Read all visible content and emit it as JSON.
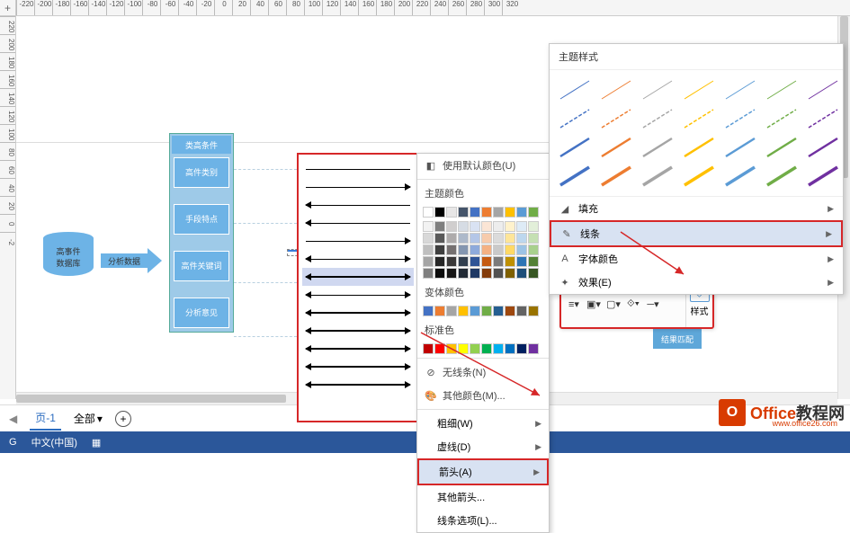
{
  "ruler_h": [
    "-220",
    "-200",
    "-180",
    "-160",
    "-140",
    "-120",
    "-100",
    "-80",
    "-60",
    "-40",
    "-20",
    "0",
    "20",
    "40",
    "60",
    "80",
    "100",
    "120",
    "140",
    "160",
    "180",
    "200",
    "220",
    "240",
    "260",
    "280",
    "300",
    "320"
  ],
  "ruler_v": [
    "220",
    "200",
    "180",
    "160",
    "140",
    "120",
    "100",
    "80",
    "60",
    "40",
    "20",
    "0",
    "-2"
  ],
  "shapes": {
    "db_line1": "高事件",
    "db_line2": "数据库",
    "arrow_label": "分析数据",
    "group_title": "类高条件",
    "box1": "高件类别",
    "box2": "手段特点",
    "box3": "高件关键词",
    "box4": "分析意见",
    "result": "结果匹配"
  },
  "color_menu": {
    "default_label": "使用默认颜色(U)",
    "theme_label": "主题颜色",
    "variant_label": "变体颜色",
    "standard_label": "标准色",
    "no_line": "无线条(N)",
    "other_colors": "其他颜色(M)...",
    "weight": "粗细(W)",
    "dashes": "虚线(D)",
    "arrows": "箭头(A)",
    "other_arrows": "其他箭头...",
    "line_options": "线条选项(L)..."
  },
  "theme_panel": {
    "title": "主题样式",
    "fill": "填充",
    "line": "线条",
    "font_color": "字体颜色",
    "effects": "效果(E)"
  },
  "mini_tb": {
    "style": "样式"
  },
  "page_bar": {
    "page_tab": "页-1",
    "all": "全部"
  },
  "status": {
    "lang": "中文(中国)"
  },
  "watermark": {
    "text1": "Office",
    "text2": "教程网",
    "sub": "www.office26.com"
  },
  "theme_colors": [
    [
      "#4472c4",
      "#ed7d31",
      "#a5a5a5",
      "#ffc000",
      "#5b9bd5",
      "#70ad47",
      "#7030a0"
    ],
    [
      "#4472c4",
      "#ed7d31",
      "#a5a5a5",
      "#ffc000",
      "#5b9bd5",
      "#70ad47",
      "#7030a0"
    ],
    [
      "#4472c4",
      "#ed7d31",
      "#a5a5a5",
      "#ffc000",
      "#5b9bd5",
      "#70ad47",
      "#7030a0"
    ],
    [
      "#4472c4",
      "#ed7d31",
      "#a5a5a5",
      "#ffc000",
      "#5b9bd5",
      "#70ad47",
      "#7030a0"
    ]
  ],
  "cm_theme_colors": [
    "#ffffff",
    "#000000",
    "#e7e6e6",
    "#44546a",
    "#4472c4",
    "#ed7d31",
    "#a5a5a5",
    "#ffc000",
    "#5b9bd5",
    "#70ad47"
  ],
  "cm_theme_shades": [
    [
      "#f2f2f2",
      "#7f7f7f",
      "#d0cece",
      "#d6dce4",
      "#d9e2f3",
      "#fbe5d5",
      "#ededed",
      "#fff2cc",
      "#deebf6",
      "#e2efd9"
    ],
    [
      "#d8d8d8",
      "#595959",
      "#aeabab",
      "#adb9ca",
      "#b4c6e7",
      "#f7cbac",
      "#dbdbdb",
      "#fee599",
      "#bdd7ee",
      "#c5e0b3"
    ],
    [
      "#bfbfbf",
      "#3f3f3f",
      "#757070",
      "#8496b0",
      "#8eaadb",
      "#f4b183",
      "#c9c9c9",
      "#ffd965",
      "#9cc3e5",
      "#a8d08d"
    ],
    [
      "#a5a5a5",
      "#262626",
      "#3a3838",
      "#323f4f",
      "#2f5496",
      "#c55a11",
      "#7b7b7b",
      "#bf9000",
      "#2e75b5",
      "#538135"
    ],
    [
      "#7f7f7f",
      "#0c0c0c",
      "#171616",
      "#222a35",
      "#1f3864",
      "#833c0b",
      "#525252",
      "#7f6000",
      "#1e4e79",
      "#375623"
    ]
  ],
  "cm_variant_colors": [
    "#4472c4",
    "#ed7d31",
    "#a5a5a5",
    "#ffc000",
    "#5b9bd5",
    "#70ad47",
    "#255e91",
    "#9e480e",
    "#636363",
    "#997300"
  ],
  "cm_standard_colors": [
    "#c00000",
    "#ff0000",
    "#ffc000",
    "#ffff00",
    "#92d050",
    "#00b050",
    "#00b0f0",
    "#0070c0",
    "#002060",
    "#7030a0"
  ]
}
